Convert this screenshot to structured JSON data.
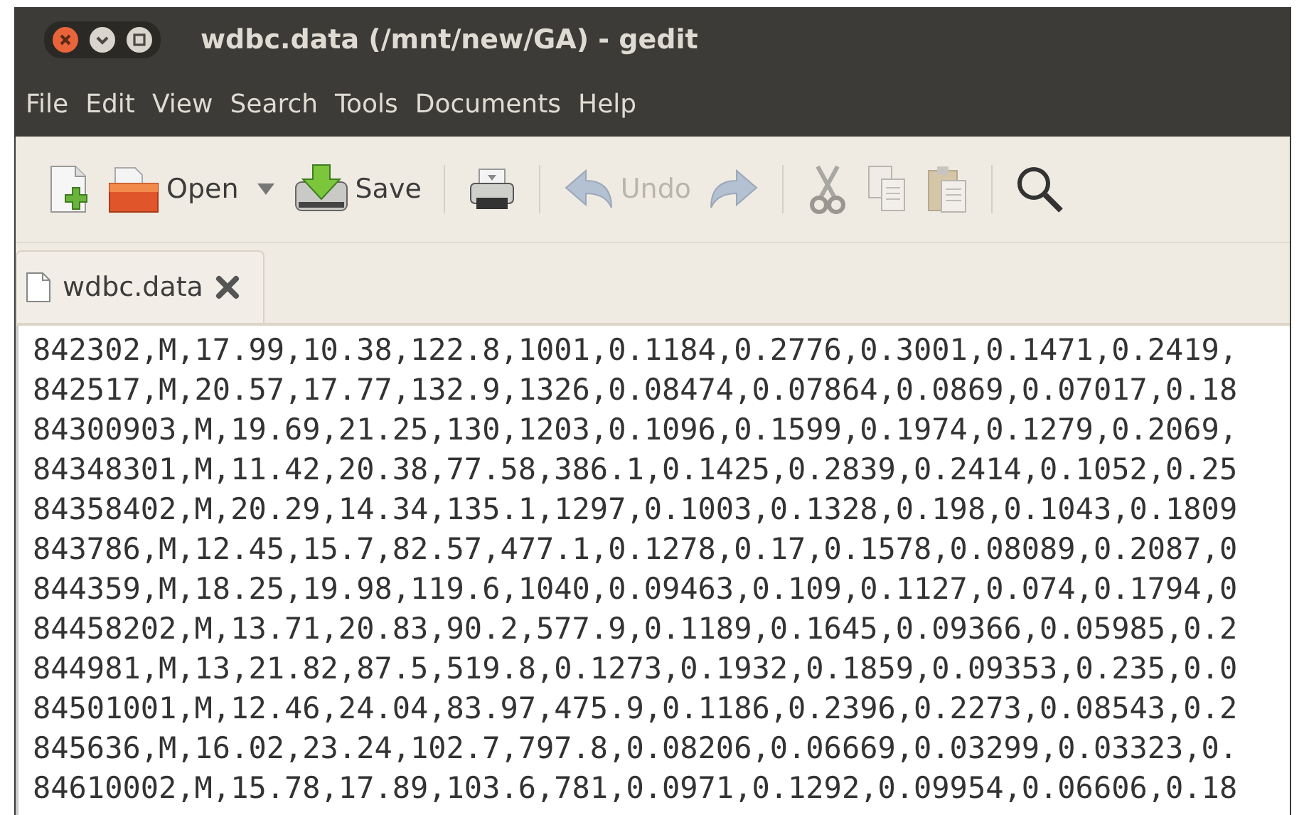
{
  "window": {
    "title": "wdbc.data (/mnt/new/GA) - gedit"
  },
  "menu": [
    "File",
    "Edit",
    "View",
    "Search",
    "Tools",
    "Documents",
    "Help"
  ],
  "toolbar": [
    [
      {
        "disabled": false
      },
      {
        "label": "Open",
        "disabled": false
      },
      {
        "disabled": false
      },
      {
        "label": "Save",
        "disabled": false
      }
    ],
    [
      {
        "disabled": false
      }
    ],
    [
      {
        "label": "Undo",
        "disabled": true
      },
      {
        "disabled": true
      }
    ],
    [
      {
        "disabled": true
      },
      {
        "disabled": true
      },
      {
        "disabled": true
      }
    ],
    [
      {
        "disabled": false
      }
    ]
  ],
  "tabs": [
    {
      "label": "wdbc.data",
      "selected": true
    }
  ],
  "lines": [
    "842302,M,17.99,10.38,122.8,1001,0.1184,0.2776,0.3001,0.1471,0.2419,",
    "842517,M,20.57,17.77,132.9,1326,0.08474,0.07864,0.0869,0.07017,0.18",
    "84300903,M,19.69,21.25,130,1203,0.1096,0.1599,0.1974,0.1279,0.2069,",
    "84348301,M,11.42,20.38,77.58,386.1,0.1425,0.2839,0.2414,0.1052,0.25",
    "84358402,M,20.29,14.34,135.1,1297,0.1003,0.1328,0.198,0.1043,0.1809",
    "843786,M,12.45,15.7,82.57,477.1,0.1278,0.17,0.1578,0.08089,0.2087,0",
    "844359,M,18.25,19.98,119.6,1040,0.09463,0.109,0.1127,0.074,0.1794,0",
    "84458202,M,13.71,20.83,90.2,577.9,0.1189,0.1645,0.09366,0.05985,0.2",
    "844981,M,13,21.82,87.5,519.8,0.1273,0.1932,0.1859,0.09353,0.235,0.0",
    "84501001,M,12.46,24.04,83.97,475.9,0.1186,0.2396,0.2273,0.08543,0.2",
    "845636,M,16.02,23.24,102.7,797.8,0.08206,0.06669,0.03299,0.03323,0.",
    "84610002,M,15.78,17.89,103.6,781,0.0971,0.1292,0.09954,0.06606,0.18"
  ]
}
